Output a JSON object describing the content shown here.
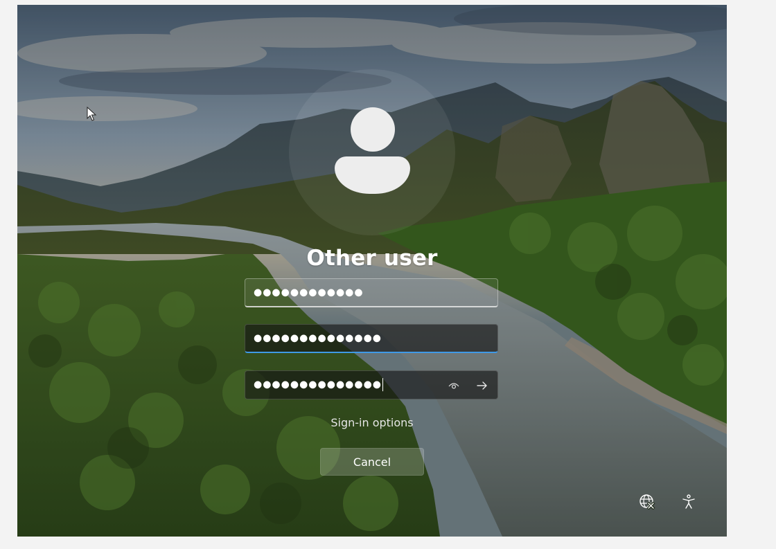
{
  "login": {
    "user_name": "Other user",
    "username_value": "●●●●●●●●●●●●",
    "password_value": "●●●●●●●●●●●●●●",
    "confirm_password_value": "●●●●●●●●●●●●●●",
    "sign_in_options_label": "Sign-in options",
    "cancel_label": "Cancel"
  },
  "icons": {
    "avatar": "user-silhouette-icon",
    "reveal": "eye-icon",
    "submit": "arrow-right-icon",
    "network": "network-globe-icon",
    "accessibility": "accessibility-icon",
    "cursor": "mouse-pointer-icon"
  },
  "colors": {
    "focus_accent": "#3f9ae6",
    "text": "#ffffff",
    "page_background": "#f3f3f3"
  }
}
